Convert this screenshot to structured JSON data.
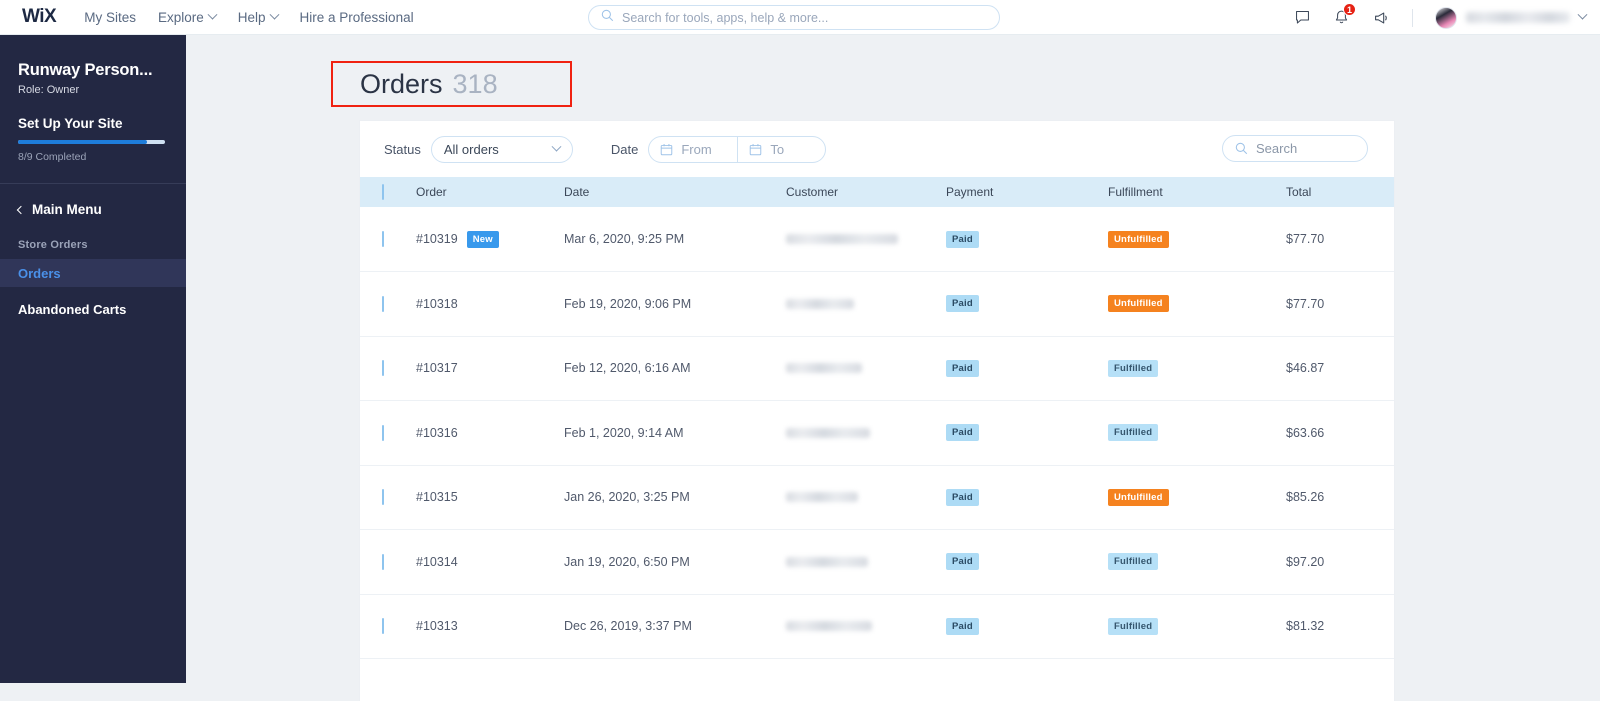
{
  "topbar": {
    "logo": "WiX",
    "nav": [
      {
        "label": "My Sites",
        "has_caret": false
      },
      {
        "label": "Explore",
        "has_caret": true
      },
      {
        "label": "Help",
        "has_caret": true
      },
      {
        "label": "Hire a Professional",
        "has_caret": false
      }
    ],
    "search_placeholder": "Search for tools, apps, help & more...",
    "icons": [
      "chat-icon",
      "bell-icon",
      "megaphone-icon"
    ],
    "notification_count": "1",
    "user_name": ""
  },
  "sidebar": {
    "site_title": "Runway Person...",
    "role": "Role: Owner",
    "setup_title": "Set Up Your Site",
    "progress_label": "8/9 Completed",
    "progress_percent": 88,
    "main_menu": "Main Menu",
    "group_label": "Store Orders",
    "items": [
      {
        "label": "Orders",
        "active": true
      },
      {
        "label": "Abandoned Carts",
        "active": false
      }
    ]
  },
  "page": {
    "title": "Orders",
    "count": "318",
    "highlight_color": "#f02211"
  },
  "filters": {
    "status_label": "Status",
    "status_value": "All orders",
    "date_label": "Date",
    "date_from_placeholder": "From",
    "date_to_placeholder": "To",
    "search_placeholder": "Search"
  },
  "table": {
    "columns": [
      "Order",
      "Date",
      "Customer",
      "Payment",
      "Fulfillment",
      "Total"
    ],
    "rows": [
      {
        "order": "#10319",
        "new": "New",
        "date": "Mar 6, 2020, 9:25 PM",
        "customer": "",
        "customer_width": 112,
        "payment": "Paid",
        "fulfillment": "Unfulfilled",
        "total": "$77.70"
      },
      {
        "order": "#10318",
        "new": "",
        "date": "Feb 19, 2020, 9:06 PM",
        "customer": "",
        "customer_width": 68,
        "payment": "Paid",
        "fulfillment": "Unfulfilled",
        "total": "$77.70"
      },
      {
        "order": "#10317",
        "new": "",
        "date": "Feb 12, 2020, 6:16 AM",
        "customer": "",
        "customer_width": 76,
        "payment": "Paid",
        "fulfillment": "Fulfilled",
        "total": "$46.87"
      },
      {
        "order": "#10316",
        "new": "",
        "date": "Feb 1, 2020, 9:14 AM",
        "customer": "",
        "customer_width": 84,
        "payment": "Paid",
        "fulfillment": "Fulfilled",
        "total": "$63.66"
      },
      {
        "order": "#10315",
        "new": "",
        "date": "Jan 26, 2020, 3:25 PM",
        "customer": "",
        "customer_width": 72,
        "payment": "Paid",
        "fulfillment": "Unfulfilled",
        "total": "$85.26"
      },
      {
        "order": "#10314",
        "new": "",
        "date": "Jan 19, 2020, 6:50 PM",
        "customer": "",
        "customer_width": 82,
        "payment": "Paid",
        "fulfillment": "Fulfilled",
        "total": "$97.20"
      },
      {
        "order": "#10313",
        "new": "",
        "date": "Dec 26, 2019, 3:37 PM",
        "customer": "",
        "customer_width": 86,
        "payment": "Paid",
        "fulfillment": "Fulfilled",
        "total": "$81.32"
      }
    ]
  }
}
